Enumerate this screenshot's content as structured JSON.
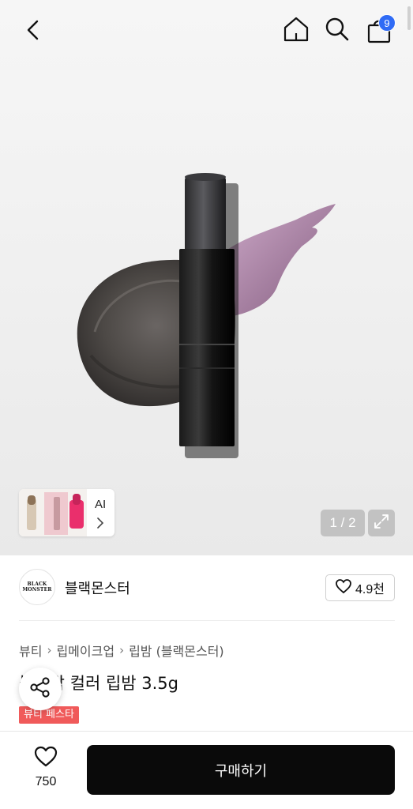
{
  "header": {
    "back_icon": "chevron-left-icon",
    "home_icon": "home-icon",
    "search_icon": "search-icon",
    "cart_icon": "shopping-bag-icon",
    "cart_count": "9"
  },
  "gallery": {
    "ai_label": "AI",
    "page_indicator": "1 / 2",
    "expand_icon": "expand-icon"
  },
  "brand": {
    "logo_line1": "BLACK",
    "logo_line2": "MONSTER",
    "name": "블랙몬스터",
    "likes": "4.9천"
  },
  "breadcrumb": [
    "뷰티",
    "립메이크업",
    "립밤 (블랙몬스터)"
  ],
  "product": {
    "title": "블랙밤 컬러 립밤 3.5g",
    "tag": "뷰티 페스타"
  },
  "bottom": {
    "wish_count": "750",
    "buy_label": "구매하기"
  },
  "colors": {
    "cart_badge": "#2f6bf5",
    "tag_bg": "#f05a5a",
    "buy_button": "#0a0a0a"
  }
}
